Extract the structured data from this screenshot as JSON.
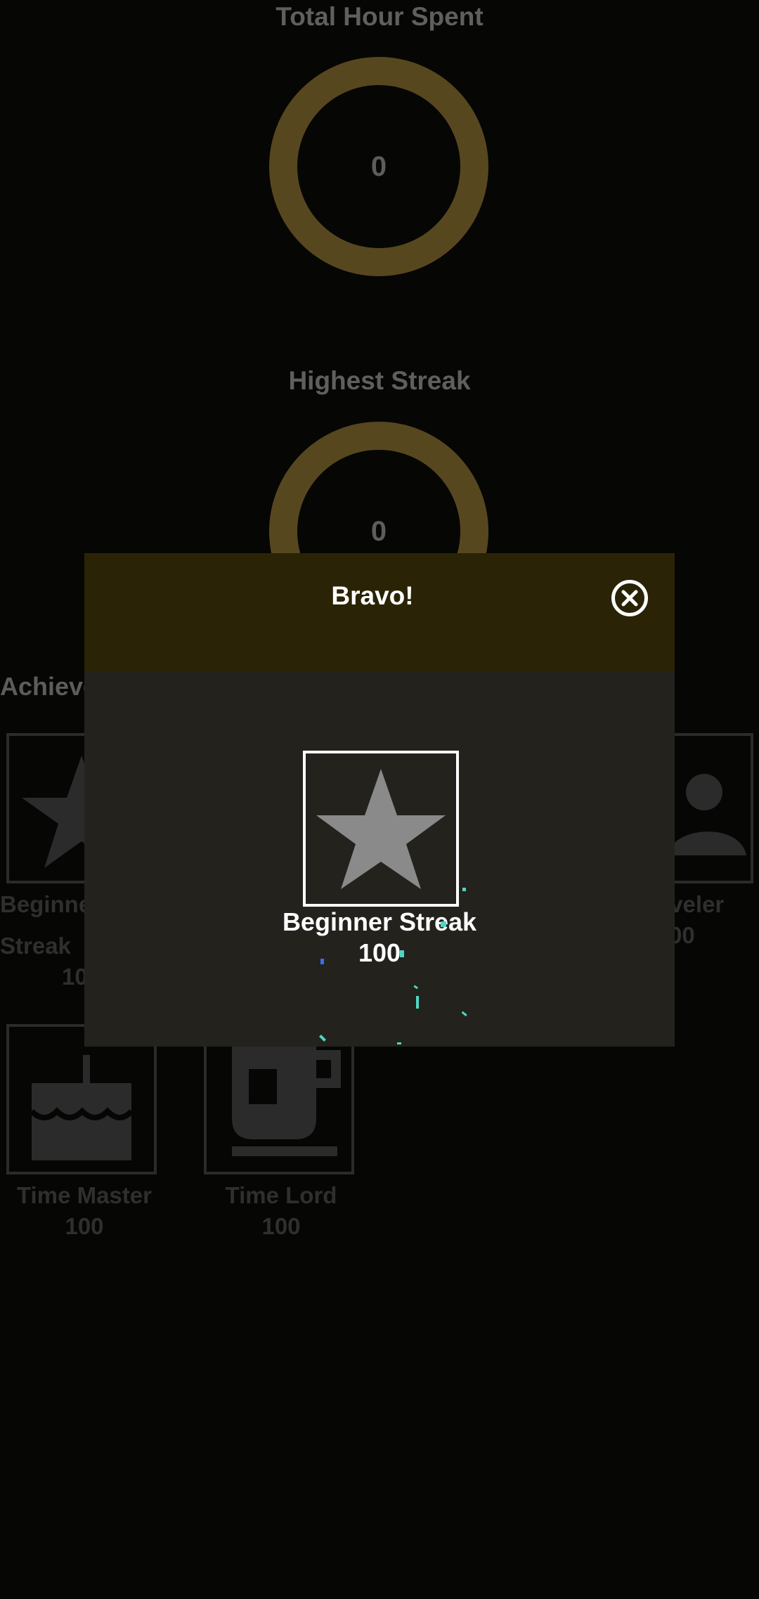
{
  "stats": {
    "total_hours": {
      "title": "Total Hour Spent",
      "value": "0"
    },
    "highest_streak": {
      "title": "Highest Streak",
      "value": "0"
    }
  },
  "achievements": {
    "title_partial": "Achieve",
    "items": [
      {
        "name_line1": "Beginne",
        "name_line2": "Streak",
        "value": "10",
        "icon": "star-icon"
      },
      {
        "name_line1": "raveler",
        "value": "00",
        "icon": "traveler-icon"
      },
      {
        "name": "Time Master",
        "value": "100",
        "icon": "cake-icon"
      },
      {
        "name": "Time Lord",
        "value": "100",
        "icon": "mug-icon"
      }
    ]
  },
  "dialog": {
    "title": "Bravo!",
    "award": {
      "name": "Beginner Streak",
      "value": "100",
      "icon": "star-icon"
    },
    "colors": {
      "header": "#2a2305",
      "body": "#23221d",
      "confetti": [
        "#4fd6c2",
        "#3a6cf0"
      ]
    }
  },
  "colors": {
    "ring": "#57471f",
    "background": "#060604"
  }
}
